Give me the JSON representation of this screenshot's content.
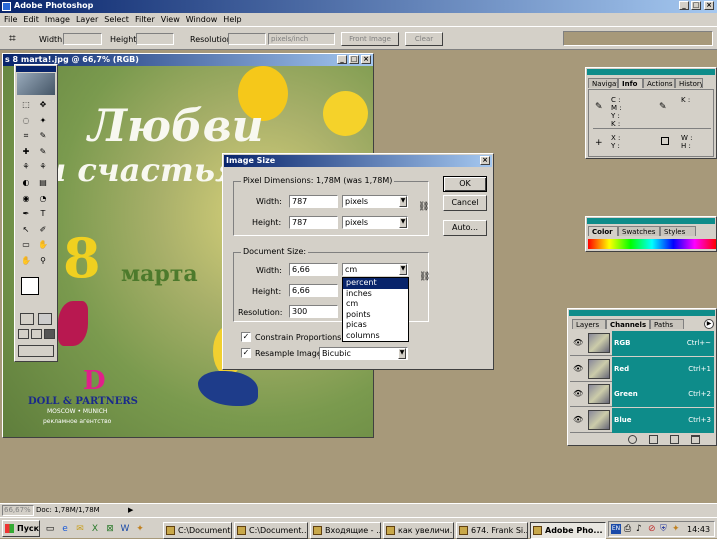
{
  "app": {
    "title": "Adobe Photoshop"
  },
  "menubar": [
    "File",
    "Edit",
    "Image",
    "Layer",
    "Select",
    "Filter",
    "View",
    "Window",
    "Help"
  ],
  "options_bar": {
    "width_label": "Width:",
    "height_label": "Height:",
    "resolution_label": "Resolution:",
    "units": "pixels/inch",
    "front_image": "Front Image",
    "clear": "Clear"
  },
  "document": {
    "title": "s 8 marta!.jpg @ 66,7% (RGB)",
    "zoom": "66,67%",
    "doc_info": "Doc: 1,78M/1,78M",
    "art": {
      "line1": "Любви",
      "line2": "и счастья!",
      "number": "8",
      "marta": "марта",
      "brand": "DOLL & PARTNERS",
      "brand_city": "MOSCOW • MUNICH",
      "brand_tag": "рекламное агентство"
    }
  },
  "dialog": {
    "title": "Image Size",
    "pixel_dims_label": "Pixel Dimensions: 1,78M (was 1,78M)",
    "width_label": "Width:",
    "width_value": "787",
    "width_unit": "pixels",
    "height_label": "Height:",
    "height_value": "787",
    "height_unit": "pixels",
    "doc_size_label": "Document Size:",
    "doc_width_label": "Width:",
    "doc_width_value": "6,66",
    "doc_width_unit": "cm",
    "doc_height_label": "Height:",
    "doc_height_value": "6,66",
    "resolution_label": "Resolution:",
    "resolution_value": "300",
    "constrain_label": "Constrain Proportions",
    "resample_label": "Resample Image:",
    "resample_value": "Bicubic",
    "ok": "OK",
    "cancel": "Cancel",
    "auto": "Auto...",
    "unit_options": [
      "percent",
      "inches",
      "cm",
      "points",
      "picas",
      "columns"
    ]
  },
  "info_panel": {
    "tabs": [
      "Navigator",
      "Info",
      "Actions",
      "History"
    ],
    "labels_cmyk": [
      "C :",
      "M :",
      "Y :",
      "K :"
    ],
    "label_k": "K :",
    "label_x": "X :",
    "label_y": "Y :",
    "label_w": "W :",
    "label_h": "H :"
  },
  "color_panel": {
    "tabs": [
      "Color",
      "Swatches",
      "Styles"
    ]
  },
  "channels_panel": {
    "tabs": [
      "Layers",
      "Channels",
      "Paths"
    ],
    "channels": [
      {
        "name": "RGB",
        "shortcut": "Ctrl+~"
      },
      {
        "name": "Red",
        "shortcut": "Ctrl+1"
      },
      {
        "name": "Green",
        "shortcut": "Ctrl+2"
      },
      {
        "name": "Blue",
        "shortcut": "Ctrl+3"
      }
    ]
  },
  "taskbar": {
    "start": "Пуск",
    "clock": "14:43",
    "tasks": [
      "C:\\Document...",
      "C:\\Document...",
      "Входящие - ...",
      "как увеличи...",
      "674. Frank Si...",
      "Adobe Pho..."
    ]
  },
  "colors": {
    "titlebar": "#08246b",
    "teal": "#0e8c8a",
    "desktop": "#a7997a"
  }
}
